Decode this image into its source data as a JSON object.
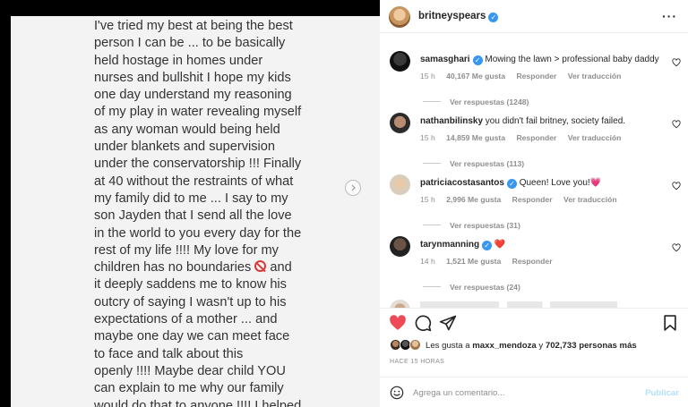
{
  "post_text": {
    "lines": [
      "I've tried my best at being the best",
      "person I can be ... to be basically",
      "held hostage in homes under",
      "nurses and bullshit I hope my kids",
      "one day understand my reasoning",
      "of my play in water revealing myself",
      "as any woman would being held",
      "under blankets and supervision",
      "under the conservatorship !!! Finally",
      "at 40 without the restraints of what",
      "my family did to me ... I say to my",
      "son Jayden that I send all the love",
      "in the world to you every day for the",
      "rest of my life !!!! My love for my",
      "children has no boundaries",
      "it deeply saddens me to know his",
      "outcry of saying I wasn't up to his",
      "expectations of a mother ... and",
      "maybe one day we can meet face",
      "to face and talk about this",
      "openly !!!! Maybe dear child YOU",
      "can explain to me why our family",
      "would do that to anyone !!!! I helped"
    ],
    "line15_suffix": "and"
  },
  "header": {
    "username": "britneyspears",
    "verified": true,
    "more_icon": "more-horizontal-icon"
  },
  "comments": [
    {
      "username": "samasghari",
      "verified": true,
      "text": "Mowing the lawn > professional baby daddy",
      "time": "15 h",
      "likes": "40,167 Me gusta",
      "reply": "Responder",
      "translate": "Ver traducción",
      "replies": "Ver respuestas (1248)"
    },
    {
      "username": "nathanbilinsky",
      "verified": false,
      "text": "you didn't fail britney, society failed.",
      "time": "15 h",
      "likes": "14,859 Me gusta",
      "reply": "Responder",
      "translate": "Ver traducción",
      "replies": "Ver respuestas (113)"
    },
    {
      "username": "patriciacostasantos",
      "verified": true,
      "text": "Queen! Love you!",
      "emoji": "💗",
      "time": "15 h",
      "likes": "2,996 Me gusta",
      "reply": "Responder",
      "translate": "Ver traducción",
      "replies": "Ver respuestas (31)"
    },
    {
      "username": "tarynmanning",
      "verified": true,
      "text": "",
      "emoji": "❤️",
      "time": "14 h",
      "likes": "1,521 Me gusta",
      "reply": "Responder",
      "translate": "",
      "replies": "Ver respuestas (24)"
    }
  ],
  "actions": {
    "like_icon": "heart-filled-icon",
    "comment_icon": "comment-icon",
    "share_icon": "share-icon",
    "save_icon": "bookmark-icon",
    "like_color": "#ed4956"
  },
  "likes": {
    "prefix": "Les gusta a",
    "user": "maxx_mendoza",
    "conjunction": "y",
    "count": "702,733 personas más"
  },
  "time_ago": "HACE 15 HORAS",
  "comment_box": {
    "placeholder": "Agrega un comentario...",
    "publish": "Publicar"
  }
}
